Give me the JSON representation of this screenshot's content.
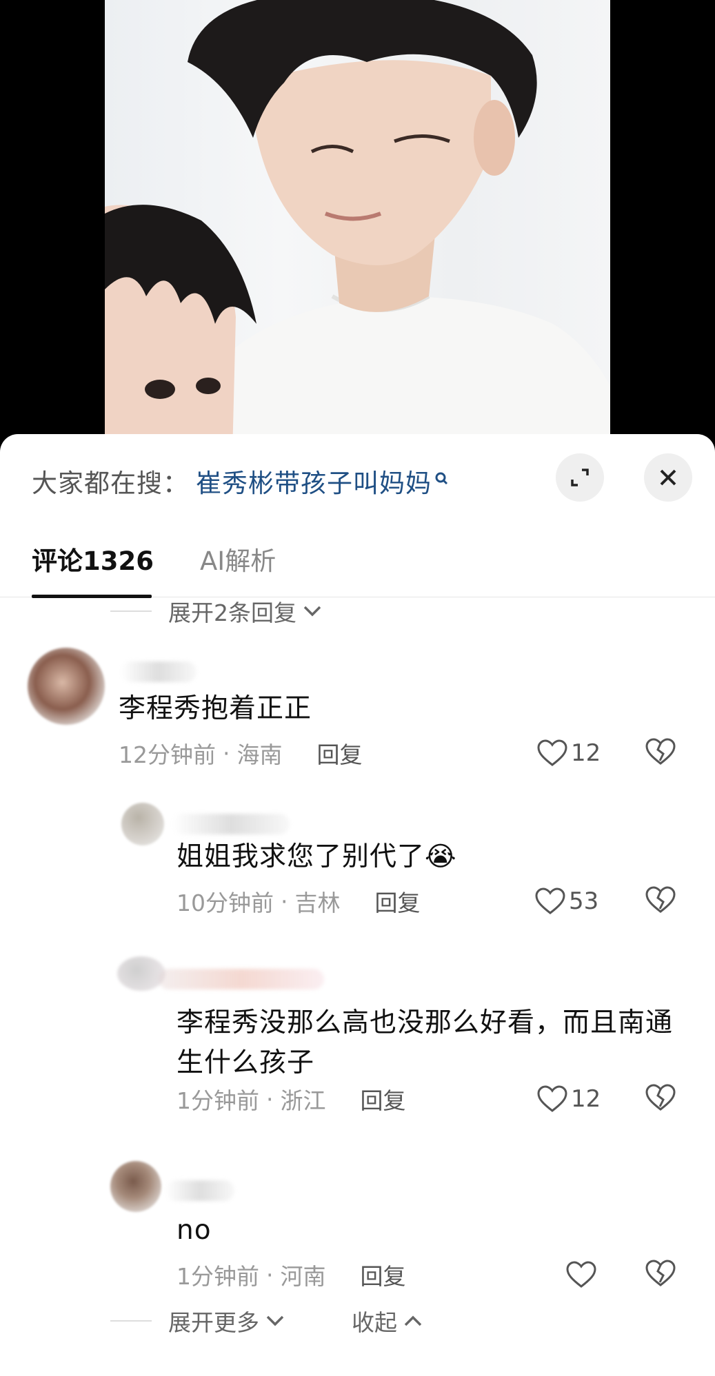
{
  "search": {
    "prefix": "大家都在搜：",
    "query": "崔秀彬带孩子叫妈妈"
  },
  "tabs": [
    {
      "label": "评论1326",
      "active": true
    },
    {
      "label": "AI解析",
      "active": false
    }
  ],
  "expand_replies_label": "展开2条回复",
  "comments": [
    {
      "text": "李程秀抱着正正",
      "time": "12分钟前",
      "region": "海南",
      "reply": "回复",
      "likes": "12"
    },
    {
      "text": "姐姐我求您了别代了😭",
      "time": "10分钟前",
      "region": "吉林",
      "reply": "回复",
      "likes": "53"
    },
    {
      "text": "李程秀没那么高也没那么好看，而且南通生什么孩子",
      "time": "1分钟前",
      "region": "浙江",
      "reply": "回复",
      "likes": "12"
    },
    {
      "text": "no",
      "time": "1分钟前",
      "region": "河南",
      "reply": "回复",
      "likes": ""
    }
  ],
  "footer": {
    "expand_more": "展开更多",
    "collapse": "收起"
  },
  "colors": {
    "search_query": "#1f4f84",
    "sheet_bg": "#ffffff",
    "video_bg": "#000000"
  }
}
